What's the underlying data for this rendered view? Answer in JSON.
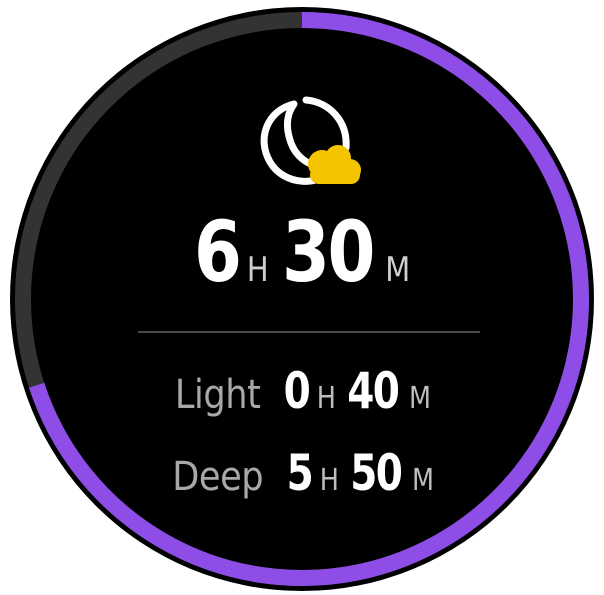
{
  "colors": {
    "background": "#000000",
    "ring_track": "#333333",
    "ring_progress": "#8e4de6",
    "moon_outline": "#ffffff",
    "cloud": "#f5c400"
  },
  "icon": "sleep-moon-cloud-icon",
  "progress": {
    "fraction": 0.7
  },
  "total": {
    "hours": "6",
    "hours_unit": "H",
    "minutes": "30",
    "minutes_unit": "M"
  },
  "light": {
    "label": "Light",
    "hours": "0",
    "hours_unit": "H",
    "minutes": "40",
    "minutes_unit": "M"
  },
  "deep": {
    "label": "Deep",
    "hours": "5",
    "hours_unit": "H",
    "minutes": "50",
    "minutes_unit": "M"
  }
}
